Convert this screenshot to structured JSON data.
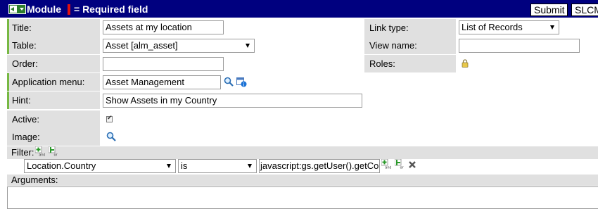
{
  "header": {
    "title": "Module",
    "required_legend": "= Required field",
    "buttons": {
      "submit": "Submit",
      "slcm": "SLCM"
    },
    "colors": {
      "bar": "#00007f",
      "required_marker": "#e01010"
    }
  },
  "form": {
    "title": {
      "label": "Title:",
      "value": "Assets at my location"
    },
    "table": {
      "label": "Table:",
      "value": "Asset [alm_asset]"
    },
    "order": {
      "label": "Order:",
      "value": ""
    },
    "application_menu": {
      "label": "Application menu:",
      "value": "Asset Management"
    },
    "hint": {
      "label": "Hint:",
      "value": "Show Assets in my Country"
    },
    "active": {
      "label": "Active:",
      "checked": true
    },
    "image": {
      "label": "Image:"
    },
    "link_type": {
      "label": "Link type:",
      "value": "List of Records"
    },
    "view_name": {
      "label": "View name:",
      "value": ""
    },
    "roles": {
      "label": "Roles:"
    }
  },
  "filter": {
    "label": "Filter:",
    "condition": {
      "field": "Location.Country",
      "operator": "is",
      "value": "javascript:gs.getUser().getCo"
    }
  },
  "arguments": {
    "label": "Arguments:",
    "value": ""
  },
  "icons": [
    "back-arrow-icon",
    "search-icon",
    "reference-info-icon",
    "lock-icon",
    "checkbox-icon",
    "add-and-condition-icon",
    "add-or-condition-icon",
    "delete-condition-icon"
  ],
  "colors": {
    "mandatory_marker": "#77b843",
    "label_background": "#e0e0e0"
  }
}
